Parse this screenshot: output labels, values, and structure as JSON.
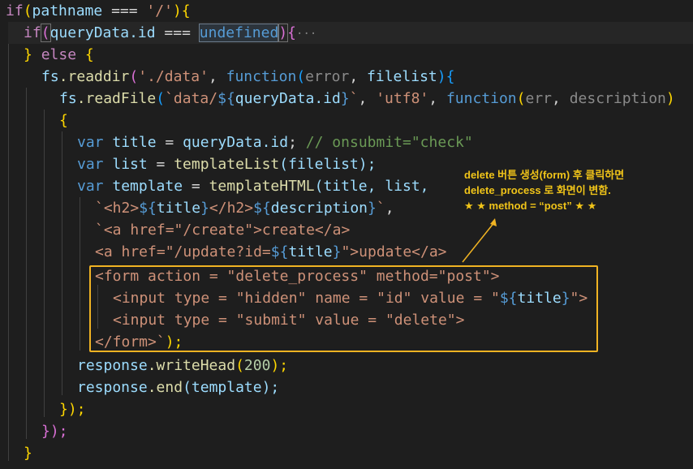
{
  "code": {
    "l1_indent": "",
    "l1_if": "if",
    "l1_paren": "(",
    "l1_var": "pathname",
    "l1_op": " === ",
    "l1_str": "'/'",
    "l1_close": "){",
    "l2_if": "if",
    "l2_paren": "(",
    "l2_var": "queryData",
    "l2_id": ".id",
    "l2_op": " === ",
    "l2_undef": "undefined",
    "l2_close": ")",
    "l2_brace": "{",
    "l2_fold": "···",
    "l3_close": "} ",
    "l3_else": "else",
    "l3_open": " {",
    "l4_obj": "fs",
    "l4_fn": ".readdir",
    "l4_p": "(",
    "l4_str": "'./data'",
    "l4_comma": ", ",
    "l4_func": "function",
    "l4_p2": "(",
    "l4_err": "error",
    "l4_c2": ", ",
    "l4_fl": "filelist",
    "l4_close": "){",
    "l5_obj": "fs",
    "l5_fn": ".readFile",
    "l5_p": "(",
    "l5_tpl1": "`data/",
    "l5_dollar": "${",
    "l5_var": "queryData.id",
    "l5_dend": "}",
    "l5_tpl2": "`",
    "l5_comma": ", ",
    "l5_str": "'utf8'",
    "l5_c2": ", ",
    "l5_func": "function",
    "l5_p2": "(",
    "l5_err": "err",
    "l5_c3": ", ",
    "l5_desc": "description",
    "l5_close": ")",
    "l6_brace": "{",
    "l7_var": "var",
    "l7_name": " title",
    "l7_eq": " = ",
    "l7_val": "queryData.id",
    "l7_semi": "; ",
    "l7_cm": "// onsubmit=\"check\"",
    "l8_var": "var",
    "l8_name": " list",
    "l8_eq": " = ",
    "l8_fn": "templateList",
    "l8_args": "(filelist);",
    "l9_var": "var",
    "l9_name": " template",
    "l9_eq": " = ",
    "l9_fn": "templateHTML",
    "l9_args": "(title, list,",
    "l10_a": "`",
    "l10_b": "<h2>",
    "l10_c": "${",
    "l10_d": "title",
    "l10_e": "}",
    "l10_f": "</h2>",
    "l10_g": "${",
    "l10_h": "description",
    "l10_i": "}",
    "l10_j": "`",
    "l10_k": ",",
    "l11_a": "`",
    "l11_b": "<a href=\"/create\">create</a>",
    "l12_a": "<a href=\"/update?id=",
    "l12_b": "${",
    "l12_c": "title",
    "l12_d": "}",
    "l12_e": "\">update</a>",
    "l13": "<form action = \"delete_process\" method=\"post\">",
    "l14_a": "<input type = \"hidden\" name = \"id\" value = \"",
    "l14_b": "${",
    "l14_c": "title",
    "l14_d": "}",
    "l14_e": "\">",
    "l15": "<input type = \"submit\" value = \"delete\">",
    "l16_a": "</form>",
    "l16_b": "`",
    "l16_c": ");",
    "l17_obj": "response",
    "l17_fn": ".writeHead",
    "l17_p": "(",
    "l17_num": "200",
    "l17_close": ");",
    "l18_obj": "response",
    "l18_fn": ".end",
    "l18_args": "(template);",
    "l19": "});",
    "l20": "});",
    "l21": "}"
  },
  "annotation": {
    "line1": "delete 버튼 생성(form) 후 클릭하면",
    "line2": "delete_process 로 화면이 변함.",
    "line3": "★ ★ method = “post” ★ ★",
    "color": "#f0b323"
  },
  "theme": {
    "background": "#1e1e1e",
    "keyword": "#569cd6",
    "control": "#c586c0",
    "string": "#ce9178",
    "variable": "#9cdcfe",
    "function": "#dcdcaa",
    "comment": "#6a9955"
  }
}
